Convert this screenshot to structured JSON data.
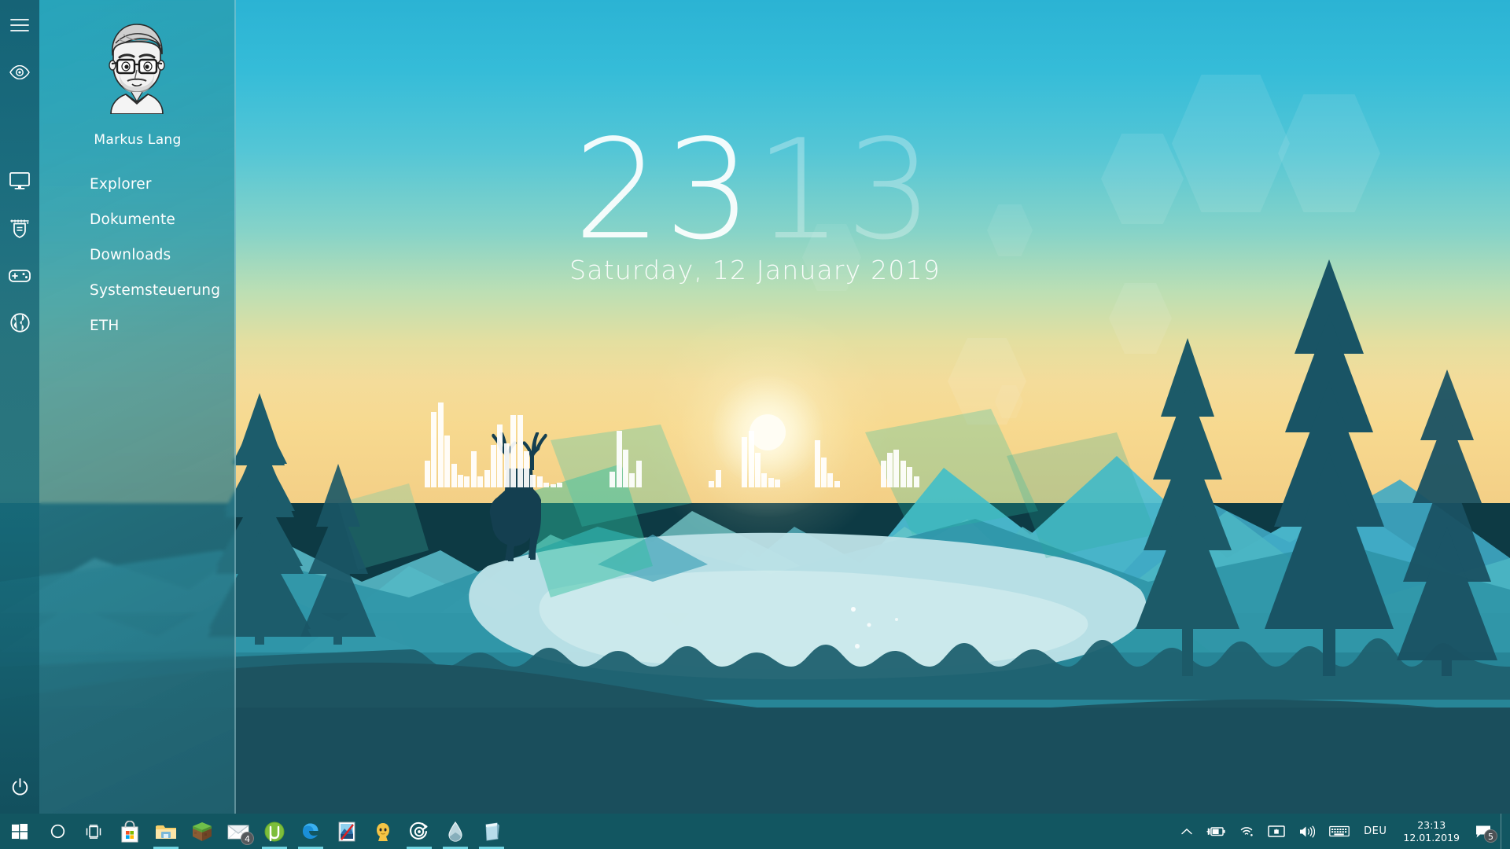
{
  "desktop": {
    "wallpaper_name": "firewatch-mountain-lake-deer",
    "colors": {
      "sky_top": "#2bb3d4",
      "sky_horizon": "#f4dc9a",
      "water": "#bfe3e8",
      "foreground": "#1d5360",
      "taskbar": "#125661",
      "accent": "#6fd3e0"
    }
  },
  "clock_widget": {
    "hours": "23",
    "minutes": "13",
    "date": "Saturday, 12  January  2019"
  },
  "visualizer": {
    "name": "audio-spectrum-visualizer",
    "bars": [
      34,
      96,
      108,
      66,
      30,
      16,
      14,
      46,
      14,
      22,
      54,
      80,
      56,
      92,
      92,
      46,
      16,
      14,
      6,
      4,
      6,
      0,
      0,
      0,
      0,
      0,
      0,
      0,
      20,
      72,
      48,
      18,
      34,
      0,
      0,
      0,
      0,
      0,
      0,
      0,
      0,
      0,
      0,
      8,
      22,
      0,
      0,
      0,
      64,
      72,
      44,
      18,
      12,
      10,
      0,
      0,
      0,
      0,
      0,
      60,
      38,
      18,
      8,
      0,
      0,
      0,
      0,
      0,
      0,
      34,
      44,
      48,
      34,
      26,
      14,
      0,
      0,
      0
    ]
  },
  "icon_rail": {
    "items": [
      {
        "name": "hamburger-icon",
        "label": "Menu"
      },
      {
        "name": "eye-icon",
        "label": "Visibility"
      },
      {
        "name": "monitor-icon",
        "label": "Display"
      },
      {
        "name": "certificate-icon",
        "label": "Certificate"
      },
      {
        "name": "gamepad-icon",
        "label": "Games"
      },
      {
        "name": "globe-icon",
        "label": "Web"
      }
    ],
    "power": {
      "name": "power-icon",
      "label": "Power"
    }
  },
  "menu_panel": {
    "user_name": "Markus Lang",
    "avatar_name": "user-avatar-bitmoji",
    "items": [
      {
        "label": "Explorer"
      },
      {
        "label": "Dokumente"
      },
      {
        "label": "Downloads"
      },
      {
        "label": "Systemsteuerung"
      },
      {
        "label": "ETH"
      }
    ]
  },
  "taskbar": {
    "start": {
      "name": "windows-start-icon",
      "label": "Start"
    },
    "search": {
      "name": "cortana-search-icon",
      "label": "Cortana"
    },
    "task_view": {
      "name": "task-view-icon",
      "label": "Task View"
    },
    "pinned": [
      {
        "name": "microsoft-store-icon",
        "label": "Microsoft Store",
        "running": false,
        "badge": ""
      },
      {
        "name": "file-explorer-icon",
        "label": "File Explorer",
        "running": true,
        "badge": ""
      },
      {
        "name": "minecraft-icon",
        "label": "Minecraft",
        "running": false,
        "badge": ""
      },
      {
        "name": "mail-icon",
        "label": "Mail",
        "running": false,
        "badge": "4"
      },
      {
        "name": "utorrent-icon",
        "label": "uTorrent",
        "running": true,
        "badge": ""
      },
      {
        "name": "edge-icon",
        "label": "Microsoft Edge",
        "running": true,
        "badge": ""
      },
      {
        "name": "irfanview-icon",
        "label": "IrfanView",
        "running": false,
        "badge": ""
      },
      {
        "name": "bitmoji-icon",
        "label": "Bitmoji",
        "running": false,
        "badge": ""
      },
      {
        "name": "rainmeter-icon",
        "label": "Rainmeter",
        "running": true,
        "badge": ""
      },
      {
        "name": "waterdrop-icon",
        "label": "Water Drop",
        "running": true,
        "badge": ""
      },
      {
        "name": "notepad-icon",
        "label": "Notepad",
        "running": true,
        "badge": ""
      }
    ],
    "tray": {
      "overflow": {
        "name": "chevron-up-icon",
        "label": "Show hidden icons"
      },
      "items": [
        {
          "name": "battery-charging-icon",
          "label": "Battery"
        },
        {
          "name": "wifi-icon",
          "label": "Network"
        },
        {
          "name": "display-brightness-icon",
          "label": "Display"
        },
        {
          "name": "volume-icon",
          "label": "Volume"
        },
        {
          "name": "keyboard-icon",
          "label": "Touch keyboard"
        }
      ],
      "language": "DEU",
      "clock": {
        "time": "23:13",
        "date": "12.01.2019"
      },
      "action_center": {
        "name": "action-center-icon",
        "label": "Notifications",
        "badge": "5"
      },
      "show_desktop": {
        "name": "show-desktop-button",
        "label": "Show desktop"
      }
    }
  }
}
